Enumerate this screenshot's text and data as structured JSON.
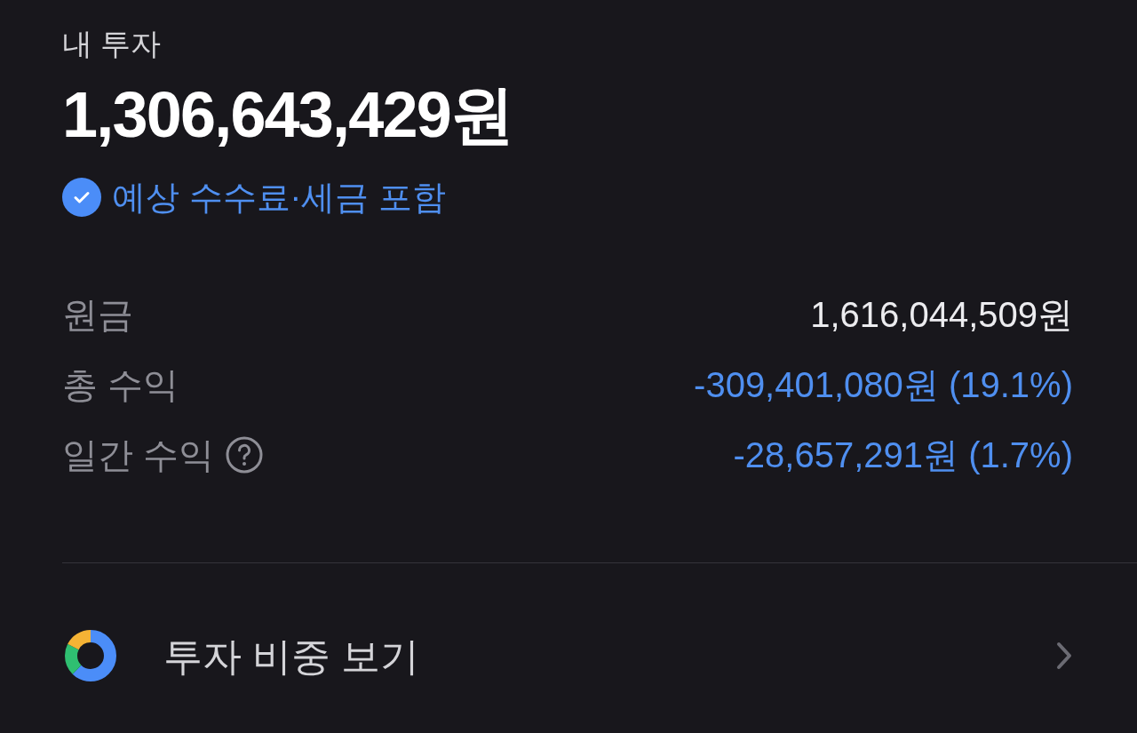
{
  "header": {
    "label": "내 투자",
    "total": "1,306,643,429원"
  },
  "fee_note": {
    "checked": true,
    "label": "예상 수수료·세금 포함"
  },
  "summary": [
    {
      "label": "원금",
      "value": "1,616,044,509원",
      "kind": "amount",
      "help": false
    },
    {
      "label": "총 수익",
      "value": "-309,401,080원 (19.1%)",
      "kind": "change",
      "help": false
    },
    {
      "label": "일간 수익",
      "value": "-28,657,291원 (1.7%)",
      "kind": "change",
      "help": true
    }
  ],
  "link": {
    "label": "투자 비중 보기"
  }
}
